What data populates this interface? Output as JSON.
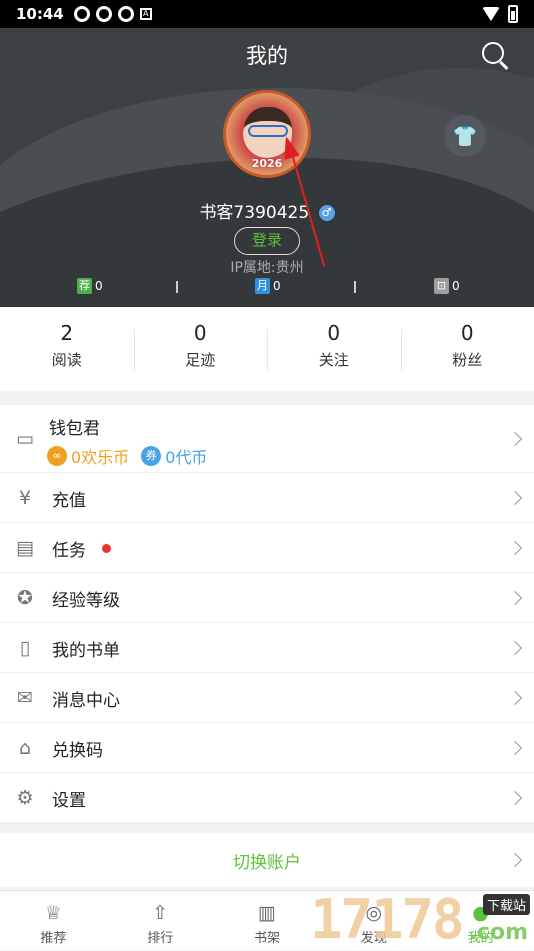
{
  "status_bar": {
    "time": "10:44",
    "a_icon": "A"
  },
  "header": {
    "title": "我的",
    "avatar_year": "2026",
    "username": "书客7390425",
    "gender_symbol": "♂",
    "login_label": "登录",
    "ip_location": "IP属地:贵州",
    "tickets": [
      {
        "badge": "荐",
        "value": "0",
        "color": "#4caf50"
      },
      {
        "badge": "月",
        "value": "0",
        "color": "#2f8fe0"
      },
      {
        "badge": "⊡",
        "value": "0",
        "color": "#9e9e9e"
      }
    ]
  },
  "stats": [
    {
      "value": "2",
      "label": "阅读"
    },
    {
      "value": "0",
      "label": "足迹"
    },
    {
      "value": "0",
      "label": "关注"
    },
    {
      "value": "0",
      "label": "粉丝"
    }
  ],
  "wallet": {
    "title": "钱包君",
    "happy_coins": "0欢乐币",
    "vouchers": "0代币",
    "happy_color": "#f0a020",
    "voucher_color": "#4aa3e0"
  },
  "menu": [
    {
      "label": "充值",
      "icon": "¥"
    },
    {
      "label": "任务",
      "icon": "▤",
      "dot": true
    },
    {
      "label": "经验等级",
      "icon": "✪"
    },
    {
      "label": "我的书单",
      "icon": "▯"
    },
    {
      "label": "消息中心",
      "icon": "✉"
    },
    {
      "label": "兑换码",
      "icon": "⌂"
    },
    {
      "label": "设置",
      "icon": "⚙"
    }
  ],
  "switch_account": "切换账户",
  "tabs": [
    {
      "label": "推荐",
      "icon": "♕"
    },
    {
      "label": "排行",
      "icon": "⇧"
    },
    {
      "label": "书架",
      "icon": "▥"
    },
    {
      "label": "发现",
      "icon": "◎"
    },
    {
      "label": "我的",
      "icon": "●"
    }
  ],
  "watermark": {
    "digits": "17178",
    "tag": "下载站",
    "suffix": ".com"
  },
  "colors": {
    "accent": "#5cc23a",
    "header_bg": "#3d4043",
    "annotation_arrow": "#e02020"
  }
}
